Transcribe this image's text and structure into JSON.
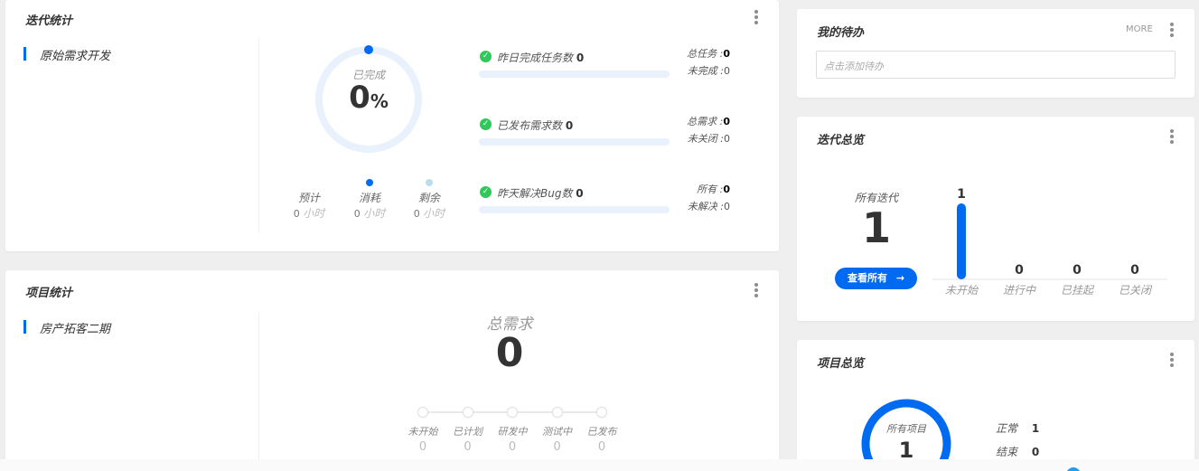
{
  "iteration_stats": {
    "title": "迭代统计",
    "side_item": "原始需求开发",
    "completed_label": "已完成",
    "completed_value": "0",
    "completed_unit": "%",
    "hours": [
      {
        "label": "预计",
        "value": "0",
        "unit": "小时"
      },
      {
        "label": "消耗",
        "value": "0",
        "unit": "小时"
      },
      {
        "label": "剩余",
        "value": "0",
        "unit": "小时"
      }
    ],
    "rows": [
      {
        "label": "昨日完成任务数",
        "value": "0",
        "r1_label": "总任务 :",
        "r1_value": "0",
        "r2_label": "未完成 :",
        "r2_value": "0"
      },
      {
        "label": "已发布需求数",
        "value": "0",
        "r1_label": "总需求 :",
        "r1_value": "0",
        "r2_label": "未关闭 :",
        "r2_value": "0"
      },
      {
        "label": "昨天解决Bug数",
        "value": "0",
        "r1_label": "所有 :",
        "r1_value": "0",
        "r2_label": "未解决 :",
        "r2_value": "0"
      }
    ]
  },
  "project_stats": {
    "title": "项目统计",
    "side_item": "房产拓客二期",
    "total_label": "总需求",
    "total_value": "0",
    "steps": [
      {
        "label": "未开始",
        "value": "0"
      },
      {
        "label": "已计划",
        "value": "0"
      },
      {
        "label": "研发中",
        "value": "0"
      },
      {
        "label": "测试中",
        "value": "0"
      },
      {
        "label": "已发布",
        "value": "0"
      }
    ]
  },
  "todo": {
    "title": "我的待办",
    "more_label": "MORE",
    "input_placeholder": "点击添加待办"
  },
  "iteration_overview": {
    "title": "迭代总览",
    "all_label": "所有迭代",
    "all_value": "1",
    "view_all_label": "查看所有",
    "arrow_icon": "arrow-right-icon"
  },
  "chart_data": {
    "type": "bar",
    "categories": [
      "未开始",
      "进行中",
      "已挂起",
      "已关闭"
    ],
    "values": [
      1,
      0,
      0,
      0
    ],
    "ylim": [
      0,
      1
    ],
    "color": "#006af1"
  },
  "project_overview": {
    "title": "项目总览",
    "ring_label": "所有项目",
    "ring_value": "1",
    "legend": [
      {
        "label": "正常",
        "value": "1"
      },
      {
        "label": "结束",
        "value": "0"
      }
    ]
  },
  "colors": {
    "accent": "#006af1",
    "success": "#30c85a",
    "ring_bg": "#e8f1fc"
  }
}
